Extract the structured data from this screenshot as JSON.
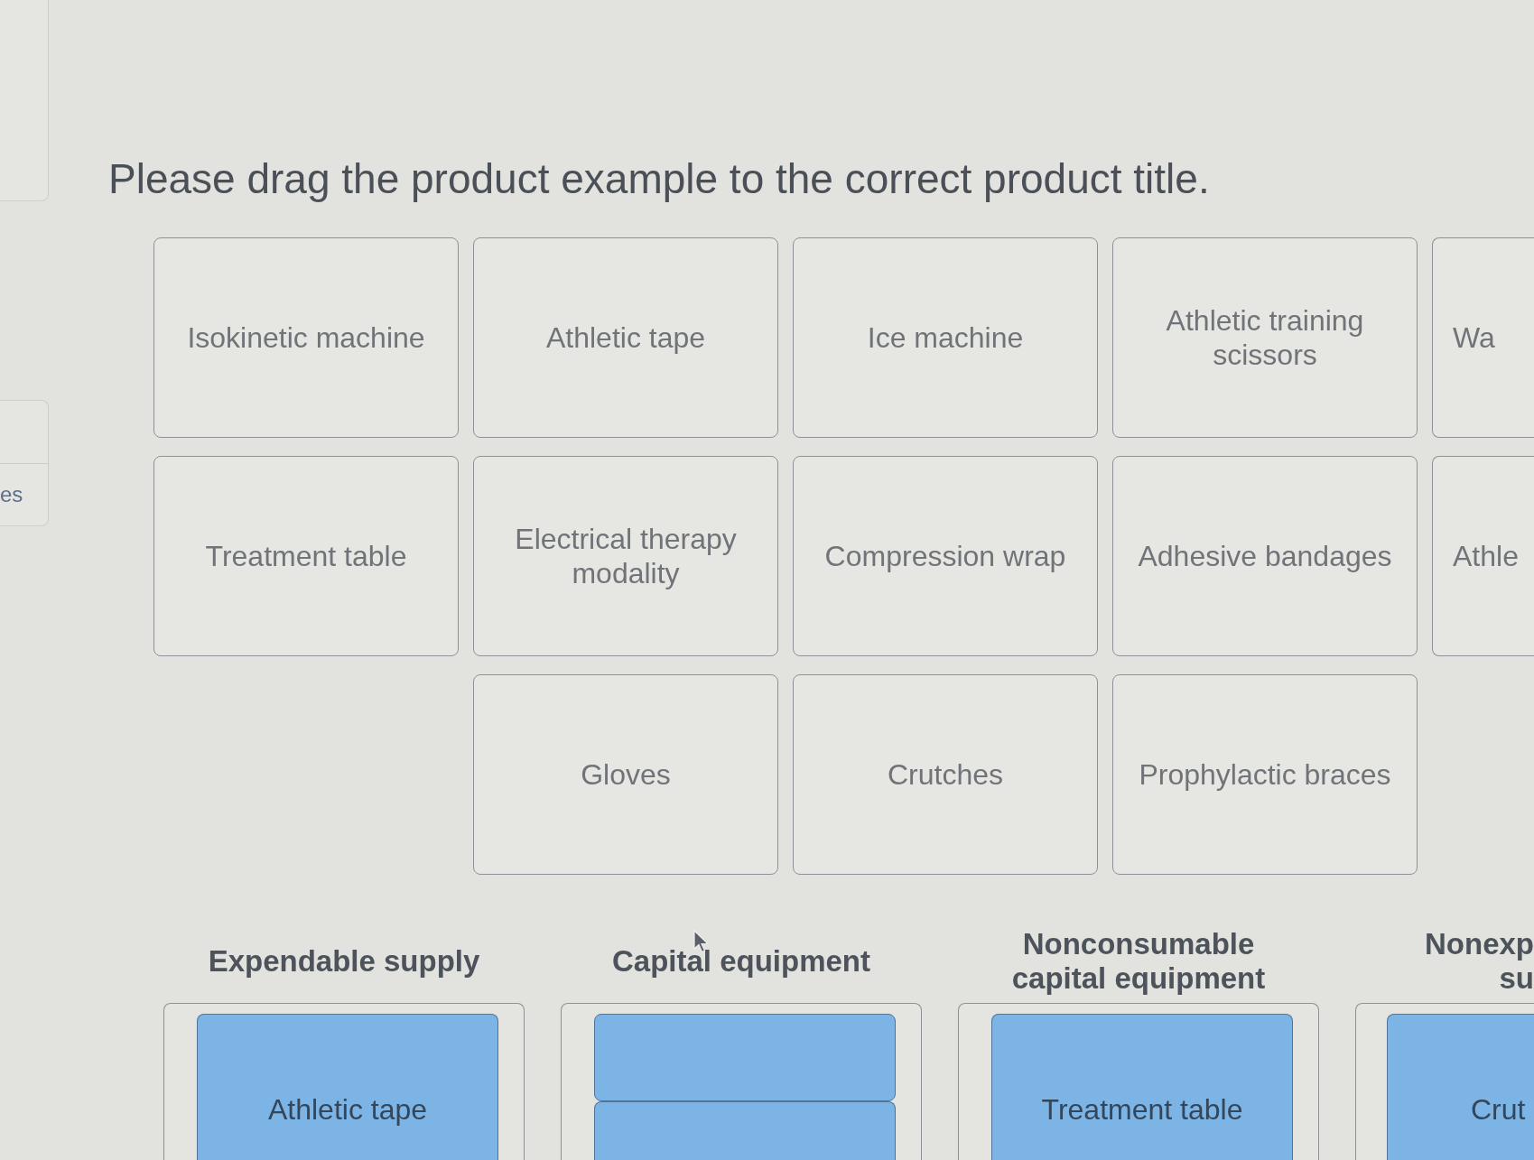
{
  "sidebar": {
    "tab_label": "es"
  },
  "instruction": "Please drag the product example to the correct product title.",
  "product_rows": [
    [
      "Isokinetic machine",
      "Athletic tape",
      "Ice machine",
      "Athletic training scissors",
      "Wa"
    ],
    [
      "Treatment table",
      "Electrical therapy modality",
      "Compression wrap",
      "Adhesive bandages",
      "Athle"
    ],
    [
      null,
      "Gloves",
      "Crutches",
      "Prophylactic braces"
    ]
  ],
  "categories": [
    {
      "title_lines": [
        "Expendable supply"
      ],
      "placed": [
        {
          "kind": "card",
          "label": "Athletic tape"
        }
      ]
    },
    {
      "title_lines": [
        "Capital equipment"
      ],
      "placed": [
        {
          "kind": "blank"
        },
        {
          "kind": "blank"
        }
      ]
    },
    {
      "title_lines": [
        "Nonconsumable",
        "capital equipment"
      ],
      "placed": [
        {
          "kind": "card",
          "label": "Treatment table"
        }
      ]
    },
    {
      "title_lines": [
        "Nonexp",
        "su"
      ],
      "placed": [
        {
          "kind": "card",
          "label": "Crut"
        }
      ]
    }
  ]
}
